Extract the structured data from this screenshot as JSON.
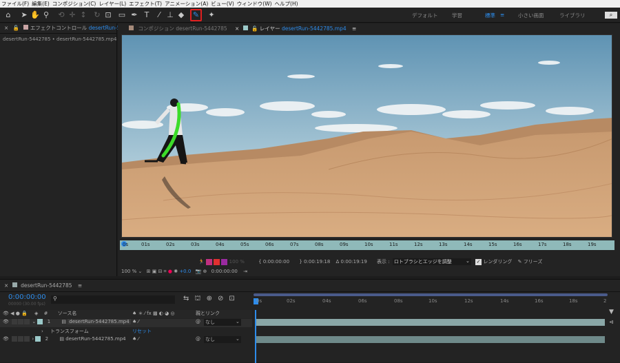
{
  "menu": [
    "ファイル(F)",
    "編集(E)",
    "コンポジション(C)",
    "レイヤー(L)",
    "エフェクト(T)",
    "アニメーション(A)",
    "ビュー(V)",
    "ウィンドウ(W)",
    "ヘルプ(H)"
  ],
  "workspaces": {
    "default": "デフォルト",
    "learn": "学習",
    "standard": "標準",
    "small": "小さい画面",
    "library": "ライブラリ"
  },
  "left_panel": {
    "tab": "エフェクトコントロール",
    "tab_file": "desertRun-5",
    "breadcrumb": "desertRun-5442785 • desertRun-5442785.mp4"
  },
  "comp_panel": {
    "tab_comp_label": "コンポジション",
    "tab_comp_name": "desertRun-5442785",
    "tab_layer_label": "レイヤー",
    "tab_layer_name": "desertRun-5442785.mp4"
  },
  "ruler_ticks": [
    "0s",
    "01s",
    "02s",
    "03s",
    "04s",
    "05s",
    "06s",
    "07s",
    "08s",
    "09s",
    "10s",
    "11s",
    "12s",
    "13s",
    "14s",
    "15s",
    "16s",
    "17s",
    "18s",
    "19s"
  ],
  "viewer_controls": {
    "zoom": "100 %",
    "opacity": "100 %",
    "time_in": "0:00:00:00",
    "time_out": "0:00:19:18",
    "duration": "Δ 0:00:19:19",
    "display_label": "表示 :",
    "display_value": "ロトブラシとエッジを調整",
    "render_label": "レンダリング",
    "freeze_label": "フリーズ",
    "exposure": "+0.0",
    "time_current": "0:00:00:00"
  },
  "timeline": {
    "tab": "desertRun-5442785",
    "timecode": "0:00:00:00",
    "timecode_sub": "00000 (30.00 fps)",
    "col_number": "#",
    "col_source": "ソース名",
    "col_parent": "親とリンク",
    "ticks": [
      "0s",
      "02s",
      "04s",
      "06s",
      "08s",
      "10s",
      "12s",
      "14s",
      "16s",
      "18s",
      "2"
    ],
    "layers": [
      {
        "num": "1",
        "name": "desertRun-5442785.mp4",
        "parent": "なし"
      },
      {
        "sub": "トランスフォーム",
        "reset": "リセット"
      },
      {
        "num": "2",
        "name": "desertRun-5442785.mp4",
        "parent": "なし"
      }
    ]
  },
  "colors": {
    "accent": "#2d8ceb",
    "ruler": "#8fb9b9",
    "highlight": "#e02020",
    "stroke": "#3ddc2a"
  }
}
